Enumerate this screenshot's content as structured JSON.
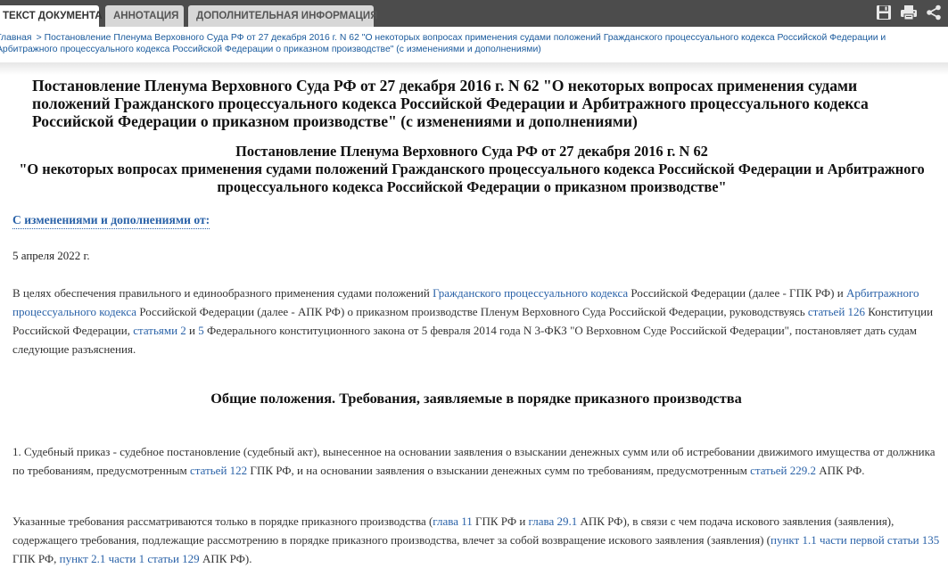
{
  "tabs": [
    {
      "label": "ТЕКСТ ДОКУМЕНТА"
    },
    {
      "label": "АННОТАЦИЯ"
    },
    {
      "label": "ДОПОЛНИТЕЛЬНАЯ ИНФОРМАЦИЯ"
    }
  ],
  "toolbar": {
    "save_icon": "floppy-disk-icon",
    "print_icon": "printer-icon",
    "share_icon": "share-icon"
  },
  "breadcrumb": {
    "home": "Главная",
    "separator": ">",
    "current": "Постановление Пленума Верховного Суда РФ от 27 декабря 2016 г. N 62 \"О некоторых вопросах применения судами положений Гражданского процессуального кодекса Российской Федерации и Арбитражного процессуального кодекса Российской Федерации о приказном производстве\" (с изменениями и дополнениями)"
  },
  "document": {
    "title": "Постановление Пленума Верховного Суда РФ от 27 декабря 2016 г. N 62 \"О некоторых вопросах применения судами положений Гражданского процессуального кодекса Российской Федерации и Арбитражного процессуального кодекса Российской Федерации о приказном производстве\" (с изменениями и дополнениями)",
    "subtitle_line1": "Постановление Пленума Верховного Суда РФ от 27 декабря 2016 г. N 62",
    "subtitle_line2": "\"О некоторых вопросах применения судами положений Гражданского процессуального кодекса Российской Федерации и Арбитражного процессуального кодекса Российской Федерации о приказном производстве\"",
    "changes_link": "С изменениями и дополнениями от:",
    "changes_date": "5 апреля 2022 г.",
    "intro": {
      "t1": "В целях обеспечения правильного и единообразного применения судами положений ",
      "l1": "Гражданского процессуального кодекса",
      "t2": " Российской Федерации (далее - ГПК РФ) и ",
      "l2": "Арбитражного процессуального кодекса",
      "t3": " Российской Федерации (далее - АПК РФ) о приказном производстве Пленум Верховного Суда Российской Федерации, руководствуясь ",
      "l3": "статьей 126",
      "t4": " Конституции Российской Федерации, ",
      "l4": "статьями 2",
      "t5": " и ",
      "l5": "5",
      "t6": " Федерального конституционного закона от 5 февраля 2014 года N 3-ФКЗ \"О Верховном Суде Российской Федерации\", постановляет дать судам следующие разъяснения."
    },
    "section_heading": "Общие положения. Требования, заявляемые в порядке приказного производства",
    "item1": {
      "t1": "1. Судебный приказ - судебное постановление (судебный акт), вынесенное на основании заявления о взыскании денежных сумм или об истребовании движимого имущества от должника по требованиям, предусмотренным ",
      "l1": "статьей 122",
      "t2": " ГПК РФ, и на основании заявления о взыскании денежных сумм по требованиям, предусмотренным ",
      "l2": "статьей 229.2",
      "t3": " АПК РФ."
    },
    "item2": {
      "t1": "Указанные требования рассматриваются только в порядке приказного производства (",
      "l1": "глава 11",
      "t2": " ГПК РФ и ",
      "l2": "глава 29.1",
      "t3": " АПК РФ), в связи с чем подача искового заявления (заявления), содержащего требования, подлежащие рассмотрению в порядке приказного производства, влечет за собой возвращение искового заявления (заявления) (",
      "l3": "пункт 1.1 части первой статьи 135",
      "t4": " ГПК РФ, ",
      "l4": "пункт 2.1 части 1 статьи 129",
      "t5": " АПК РФ)."
    }
  }
}
